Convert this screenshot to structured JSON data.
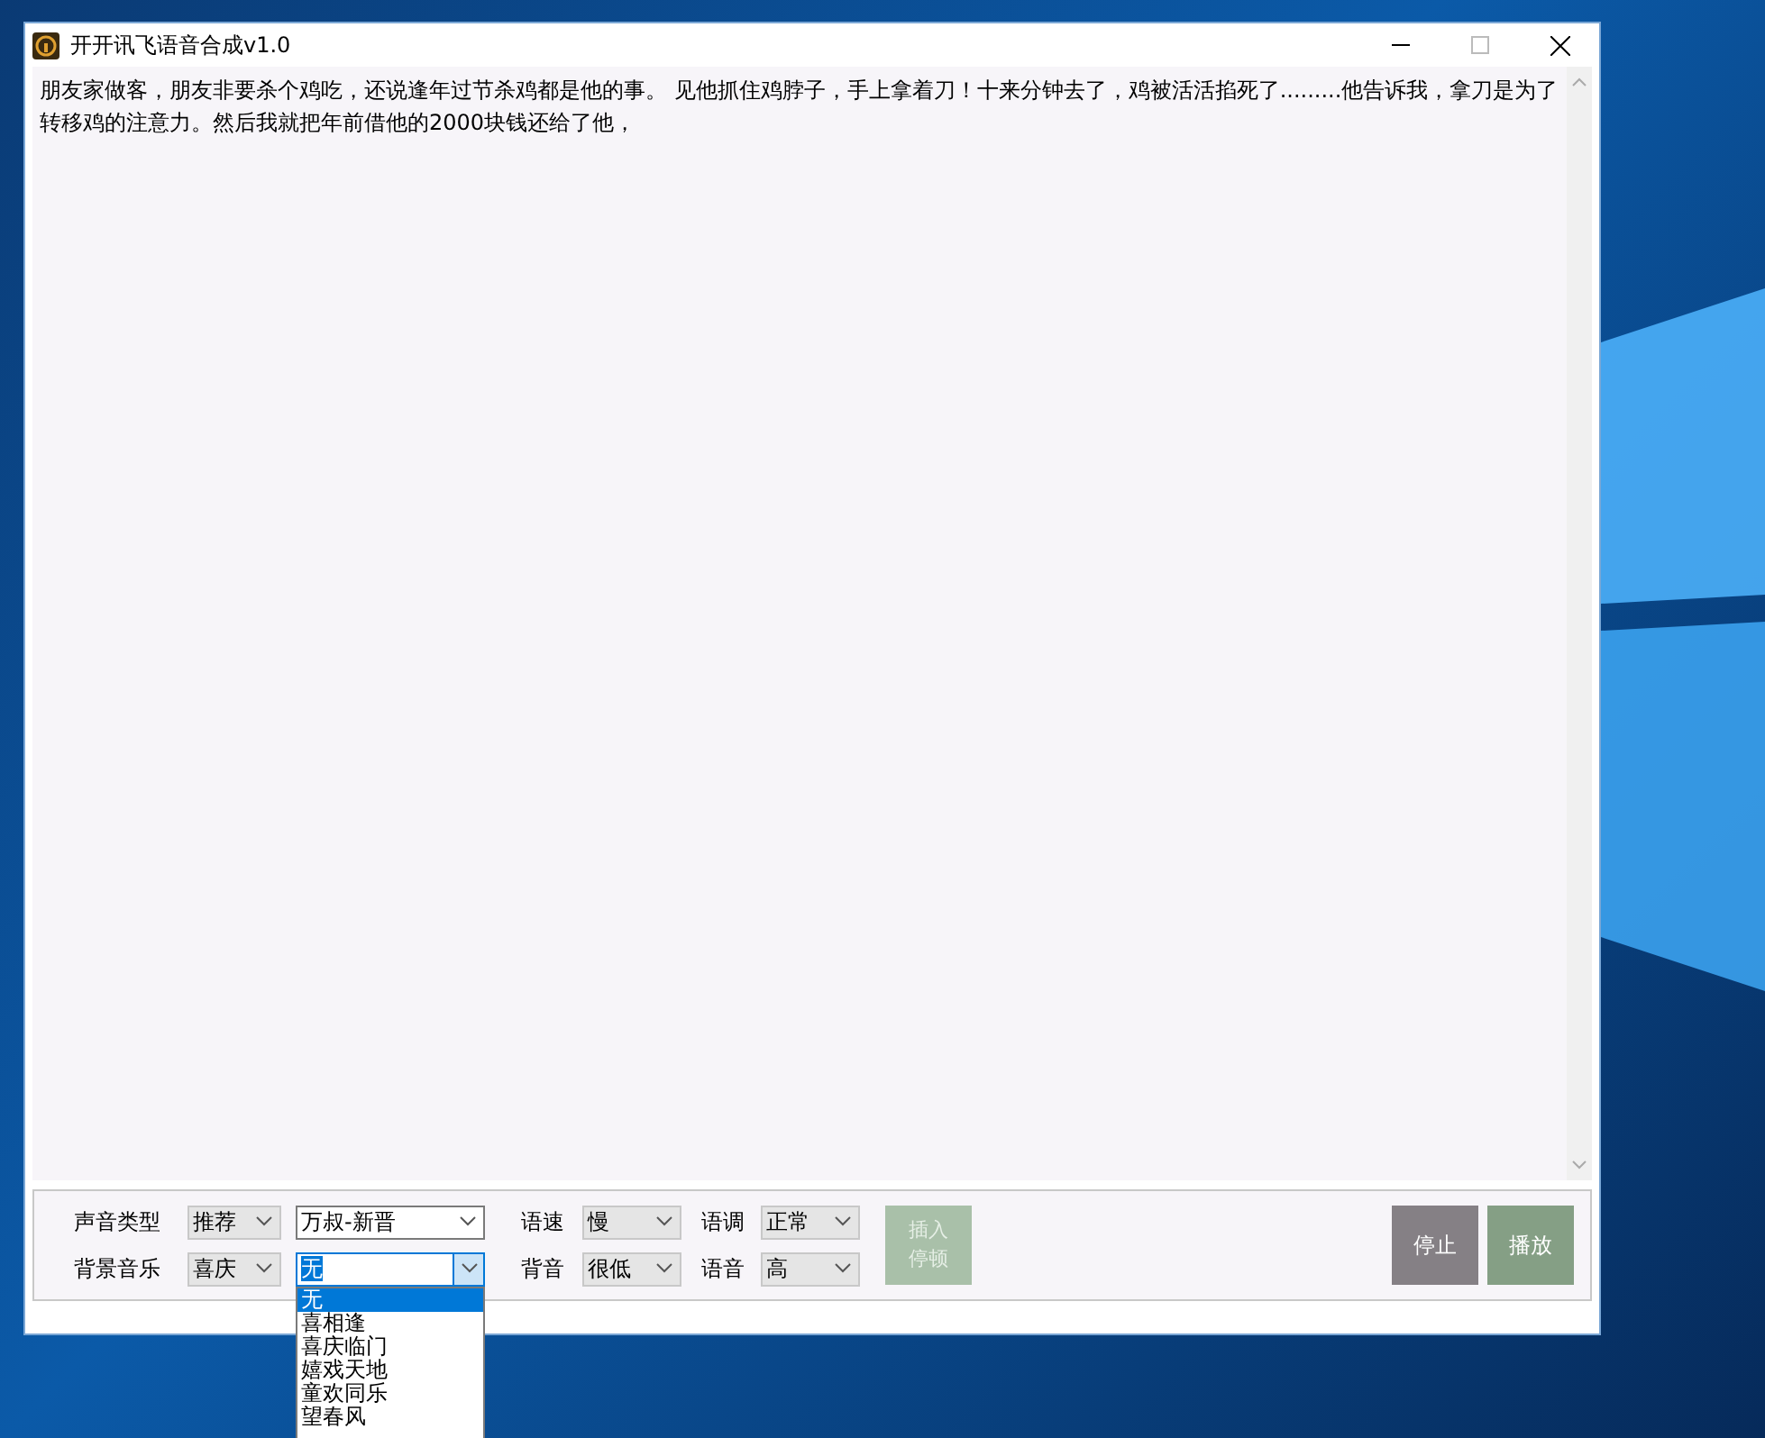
{
  "window": {
    "title": "开开讯飞语音合成v1.0"
  },
  "editor": {
    "text": "朋友家做客，朋友非要杀个鸡吃，还说逢年过节杀鸡都是他的事。 见他抓住鸡脖子，手上拿着刀！十来分钟去了，鸡被活活掐死了.........他告诉我，拿刀是为了转移鸡的注意力。然后我就把年前借他的2000块钱还给了他，"
  },
  "rows": [
    {
      "label": "声音类型",
      "select_1": {
        "value": "推荐"
      },
      "select_2": {
        "value": "万叔-新晋",
        "expanded": false
      },
      "label_2": "语速",
      "select_3": {
        "value": "慢"
      },
      "label_3": "语调",
      "select_4": {
        "value": "正常"
      }
    },
    {
      "label": "背景音乐",
      "select_1": {
        "value": "喜庆"
      },
      "select_2": {
        "value": "无",
        "expanded": true
      },
      "label_2": "背音",
      "select_3": {
        "value": "很低"
      },
      "label_3": "语音",
      "select_4": {
        "value": "高"
      }
    }
  ],
  "dropdown_options": [
    {
      "label": "无",
      "selected": true
    },
    {
      "label": "喜相逢",
      "selected": false
    },
    {
      "label": "喜庆临门",
      "selected": false
    },
    {
      "label": "嬉戏天地",
      "selected": false
    },
    {
      "label": "童欢同乐",
      "selected": false
    },
    {
      "label": "望春风",
      "selected": false
    }
  ],
  "insert_pause_button": {
    "label": "插入停顿",
    "disabled": true
  },
  "stop_button": {
    "label": "停止"
  },
  "play_button": {
    "label": "播放"
  }
}
